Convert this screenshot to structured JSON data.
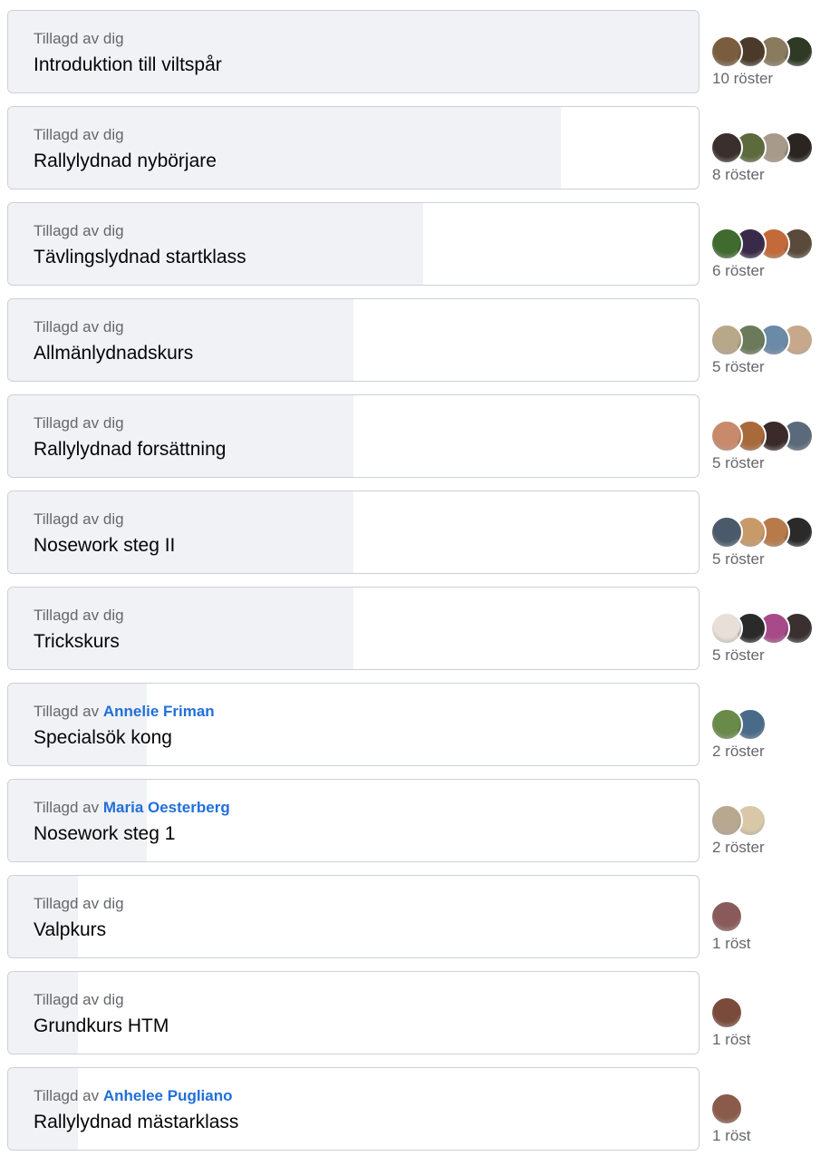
{
  "poll": {
    "max_votes": 10,
    "options": [
      {
        "added_prefix": "Tillagd av",
        "added_by": "dig",
        "added_by_is_link": false,
        "label": "Introduktion till viltspår",
        "votes": 10,
        "vote_text": "10 röster",
        "avatar_colors": [
          "#7a5c3e",
          "#4b3a2a",
          "#8a7a5e",
          "#2f3a24"
        ]
      },
      {
        "added_prefix": "Tillagd av",
        "added_by": "dig",
        "added_by_is_link": false,
        "label": "Rallylydnad nybörjare",
        "votes": 8,
        "vote_text": "8 röster",
        "avatar_colors": [
          "#3a2f2c",
          "#5c6a3c",
          "#a89a8a",
          "#2a2520"
        ]
      },
      {
        "added_prefix": "Tillagd av",
        "added_by": "dig",
        "added_by_is_link": false,
        "label": "Tävlingslydnad startklass",
        "votes": 6,
        "vote_text": "6 röster",
        "avatar_colors": [
          "#3f6b2e",
          "#3a2a4a",
          "#c46a3a",
          "#5a4a3a"
        ]
      },
      {
        "added_prefix": "Tillagd av",
        "added_by": "dig",
        "added_by_is_link": false,
        "label": "Allmänlydnadskurs",
        "votes": 5,
        "vote_text": "5 röster",
        "avatar_colors": [
          "#b8a88a",
          "#6a7a5a",
          "#6a8aa8",
          "#c8a88a"
        ]
      },
      {
        "added_prefix": "Tillagd av",
        "added_by": "dig",
        "added_by_is_link": false,
        "label": "Rallylydnad forsättning",
        "votes": 5,
        "vote_text": "5 röster",
        "avatar_colors": [
          "#c88a6a",
          "#a86a3a",
          "#3a2a2a",
          "#5a6a7a"
        ]
      },
      {
        "added_prefix": "Tillagd av",
        "added_by": "dig",
        "added_by_is_link": false,
        "label": "Nosework steg II",
        "votes": 5,
        "vote_text": "5 röster",
        "avatar_colors": [
          "#4a5a6a",
          "#c89a6a",
          "#b87a4a",
          "#2a2a2a"
        ]
      },
      {
        "added_prefix": "Tillagd av",
        "added_by": "dig",
        "added_by_is_link": false,
        "label": "Trickskurs",
        "votes": 5,
        "vote_text": "5 röster",
        "avatar_colors": [
          "#e8e0d8",
          "#2a2a2a",
          "#a84a8a",
          "#3a3030"
        ]
      },
      {
        "added_prefix": "Tillagd av",
        "added_by": "Annelie Friman",
        "added_by_is_link": true,
        "label": "Specialsök kong",
        "votes": 2,
        "vote_text": "2 röster",
        "avatar_colors": [
          "#6a8a4a",
          "#4a6a8a"
        ]
      },
      {
        "added_prefix": "Tillagd av",
        "added_by": "Maria Oesterberg",
        "added_by_is_link": true,
        "label": "Nosework steg 1",
        "votes": 2,
        "vote_text": "2 röster",
        "avatar_colors": [
          "#b8a890",
          "#d8c8a8"
        ]
      },
      {
        "added_prefix": "Tillagd av",
        "added_by": "dig",
        "added_by_is_link": false,
        "label": "Valpkurs",
        "votes": 1,
        "vote_text": "1 röst",
        "avatar_colors": [
          "#8a5a5a"
        ]
      },
      {
        "added_prefix": "Tillagd av",
        "added_by": "dig",
        "added_by_is_link": false,
        "label": "Grundkurs HTM",
        "votes": 1,
        "vote_text": "1 röst",
        "avatar_colors": [
          "#7a4a3a"
        ]
      },
      {
        "added_prefix": "Tillagd av",
        "added_by": "Anhelee Pugliano",
        "added_by_is_link": true,
        "label": "Rallylydnad mästarklass",
        "votes": 1,
        "vote_text": "1 röst",
        "avatar_colors": [
          "#8a5a4a"
        ]
      }
    ]
  },
  "colors": {
    "fill": "#f0f2f5",
    "border": "#ccd0d5",
    "link": "#216fdb",
    "secondary_text": "#65676b"
  }
}
